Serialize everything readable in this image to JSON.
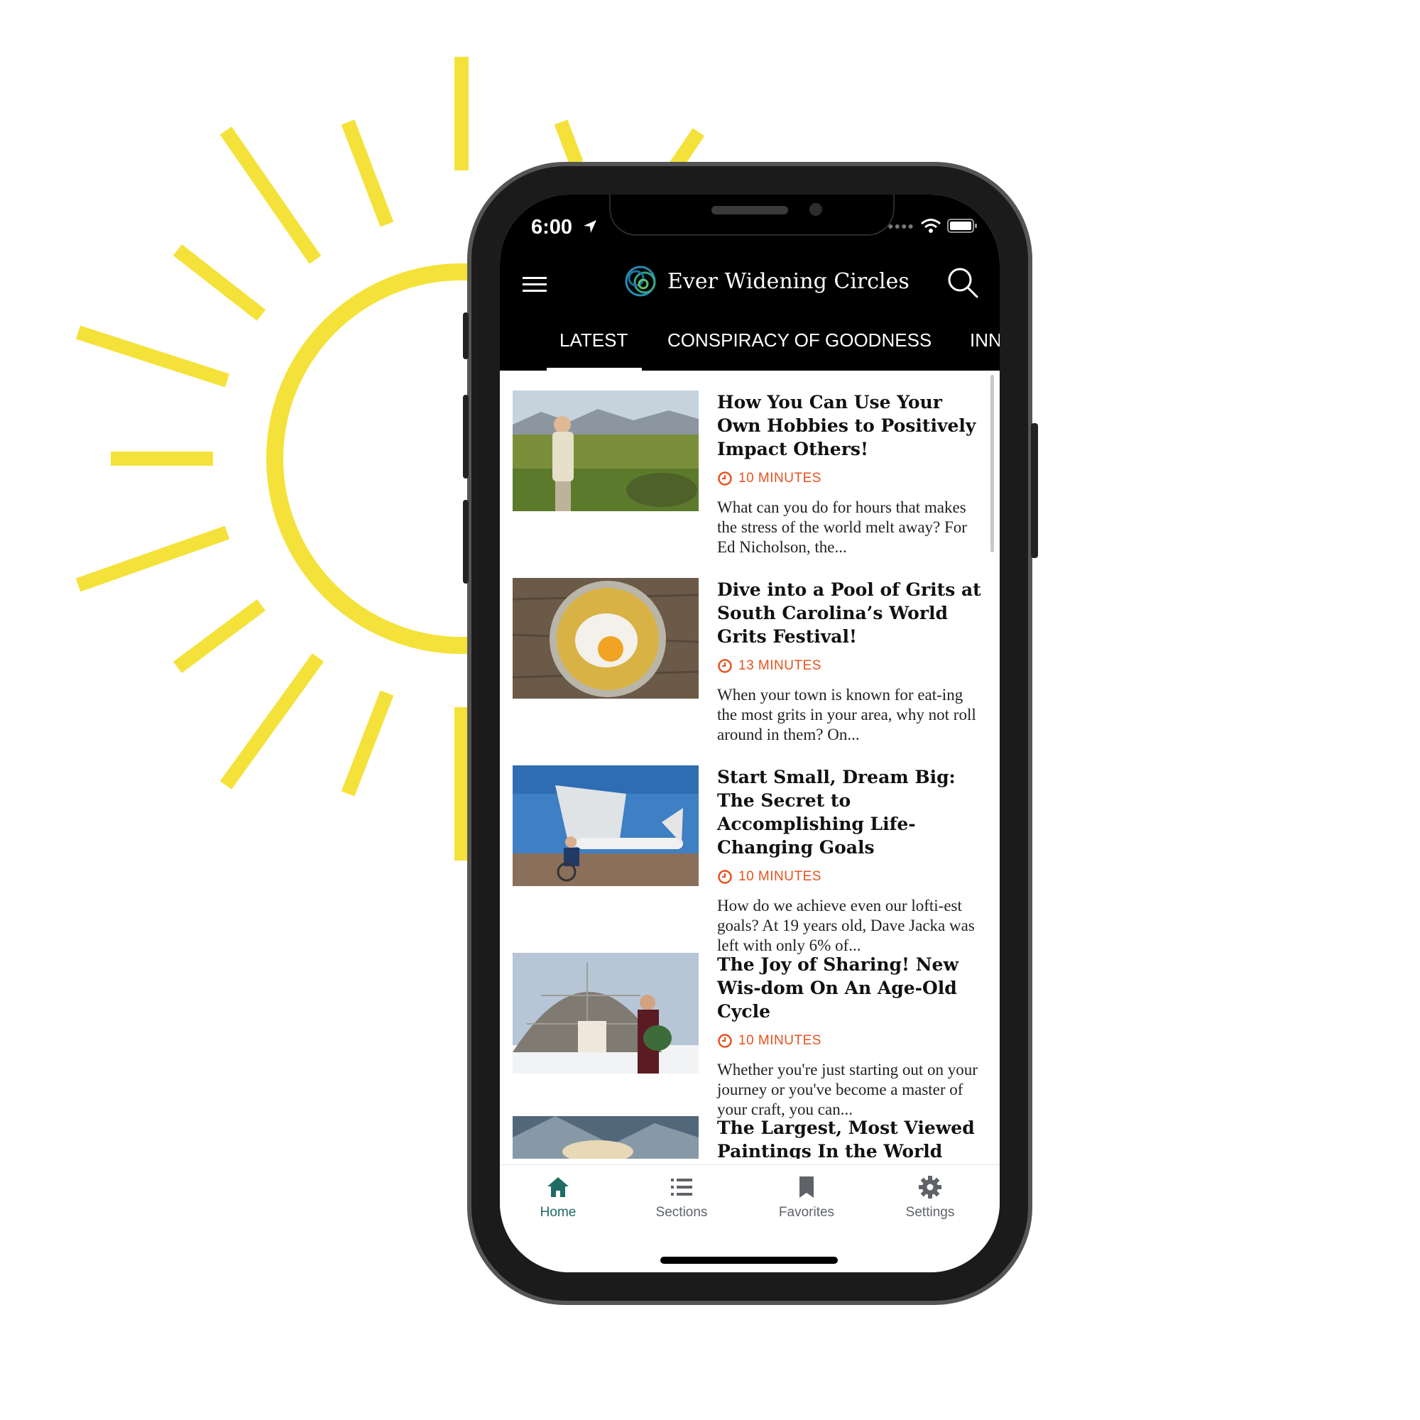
{
  "colors": {
    "sun": "#f4e23b",
    "accent_orange": "#e6531e",
    "nav_active": "#1f6c63",
    "nav_inactive": "#5f6368"
  },
  "status_bar": {
    "time": "6:00"
  },
  "header": {
    "brand": "Ever Widening Circles",
    "menu_icon": "hamburger-menu-icon",
    "search_icon": "magnifier-icon"
  },
  "tabs": [
    {
      "label": "LATEST",
      "active": true
    },
    {
      "label": "CONSPIRACY OF GOODNESS",
      "active": false
    },
    {
      "label": "INN",
      "active": false
    }
  ],
  "articles": [
    {
      "title": "How You Can Use Your Own Hobbies to Positively Impact Others!",
      "read_time": "10 MINUTES",
      "excerpt": "What can you do for hours that makes the stress of the world melt away? For Ed Nicholson, the..."
    },
    {
      "title": "Dive into a Pool of Grits at South Carolina’s World Grits Festival!",
      "read_time": "13 MINUTES",
      "excerpt": "When your town is known for eat-ing the most grits in your area, why not roll around in them? On..."
    },
    {
      "title": "Start Small, Dream Big: The Secret to Accomplishing Life-Changing Goals",
      "read_time": "10 MINUTES",
      "excerpt": "How do we achieve even our lofti-est goals? At 19 years old, Dave Jacka was left with only 6% of..."
    },
    {
      "title": "The Joy of Sharing! New Wis-dom On An Age-Old Cycle",
      "read_time": "10 MINUTES",
      "excerpt": "Whether you're just starting out on your journey or you've become a master of your craft, you can..."
    },
    {
      "title": "The Largest, Most Viewed Paintings In the World That",
      "read_time": "",
      "excerpt": ""
    }
  ],
  "bottom_nav": [
    {
      "label": "Home",
      "icon": "home-icon",
      "active": true
    },
    {
      "label": "Sections",
      "icon": "list-icon",
      "active": false
    },
    {
      "label": "Favorites",
      "icon": "bookmark-icon",
      "active": false
    },
    {
      "label": "Settings",
      "icon": "gear-icon",
      "active": false
    }
  ]
}
